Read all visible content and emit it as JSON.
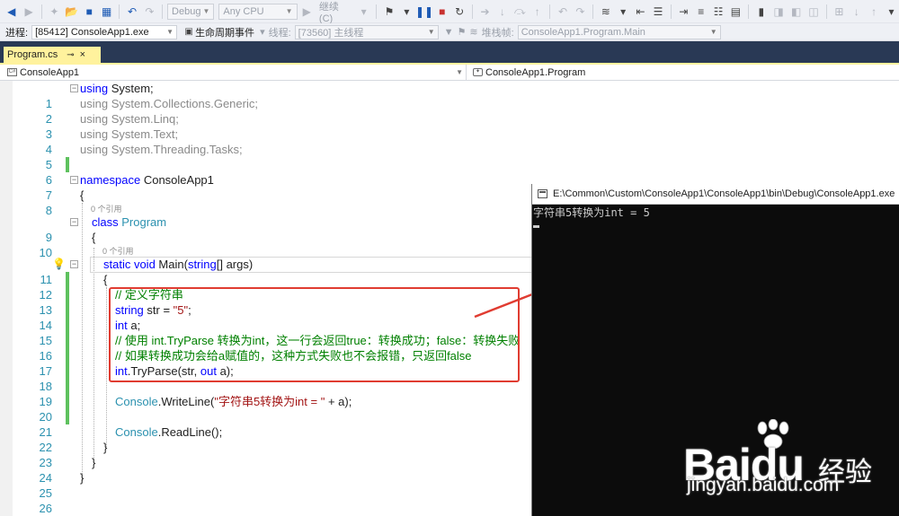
{
  "toolbar": {
    "config_value": "Debug",
    "platform_value": "Any CPU",
    "continue_label": "继续(C)",
    "accent": "#1e5bb5",
    "stop_color": "#c8312f"
  },
  "debug_location": {
    "process_label": "进程:",
    "process_value": "[85412] ConsoleApp1.exe",
    "lifecycle_label": "生命周期事件",
    "thread_label": "线程:",
    "thread_value": "[73560] 主线程",
    "stackframe_label": "堆栈帧:",
    "stackframe_value": "ConsoleApp1.Program.Main"
  },
  "tab": {
    "label": "Program.cs",
    "pin": "⊸",
    "close": "×",
    "color": "#fff29d"
  },
  "navbar": {
    "project": "ConsoleApp1",
    "type": "ConsoleApp1.Program"
  },
  "code": {
    "line_numbers": [
      "1",
      "2",
      "3",
      "4",
      "5",
      "6",
      "7",
      "8",
      "9",
      "10",
      "11",
      "12",
      "13",
      "14",
      "15",
      "16",
      "17",
      "18",
      "19",
      "20",
      "21",
      "22",
      "23",
      "24",
      "25",
      "26"
    ],
    "l1_kw": "using",
    "l1_rest": " System;",
    "l2": "using System.Collections.Generic;",
    "l3": "using System.Linq;",
    "l4": "using System.Text;",
    "l5": "using System.Threading.Tasks;",
    "l7_kw": "namespace",
    "l7_rest": " ConsoleApp1",
    "l8": "{",
    "lens_class": "0 个引用",
    "l9_kw": "class",
    "l9_type": " Program",
    "l10": "{",
    "lens_main": "0 个引用",
    "l11_kw1": "static",
    "l11_kw2": " void",
    "l11_name": " Main(",
    "l11_kw3": "string",
    "l11_rest": "[] args)",
    "l12": "{",
    "l13": "// 定义字符串",
    "l14_kw": "string",
    "l14_mid": " str = ",
    "l14_str": "\"5\"",
    "l14_end": ";",
    "l15_kw": "int",
    "l15_rest": " a;",
    "l16": "// 使用 int.TryParse 转换为int，这一行会返回true：转换成功；false：转换失败",
    "l17": "// 如果转换成功会给a赋值的，这种方式失败也不会报错，只返回false",
    "l18_kw": "int",
    "l18_mid": ".TryParse(str, ",
    "l18_kw2": "out",
    "l18_end": " a);",
    "l20_type": "Console",
    "l20_mid": ".WriteLine(",
    "l20_str": "\"字符串5转换为int = \"",
    "l20_end": " + a);",
    "l22_type": "Console",
    "l22_rest": ".ReadLine();",
    "l23": "}",
    "l24": "}",
    "l25": "}"
  },
  "console": {
    "title": "E:\\Common\\Custom\\ConsoleApp1\\ConsoleApp1\\bin\\Debug\\ConsoleApp1.exe",
    "output": "字符串5转换为int = 5"
  },
  "watermark": {
    "brand": "Bai",
    "brand2": "du",
    "brand_cn": "经验",
    "url": "jingyan.baidu.com"
  },
  "annotation_color": "#e03c31"
}
